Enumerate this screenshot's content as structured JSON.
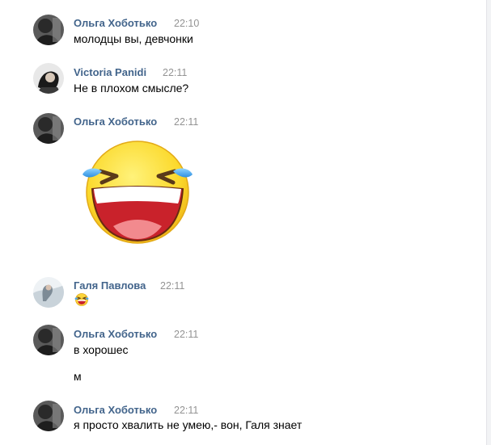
{
  "messages": [
    {
      "author": "Ольга Хоботько",
      "time": "22:10",
      "text": "молодцы вы, девчонки",
      "avatar": "olga-avatar"
    },
    {
      "author": "Victoria Panidi",
      "time": "22:11",
      "text": "Не в плохом смысле?",
      "avatar": "victoria-avatar"
    },
    {
      "author": "Ольга Хоботько",
      "time": "22:11",
      "sticker": "laughing-crying-face-sticker",
      "avatar": "olga-avatar"
    },
    {
      "author": "Галя Павлова",
      "time": "22:11",
      "emoji": "face-with-tears-of-joy-icon",
      "avatar": "galya-avatar"
    },
    {
      "author": "Ольга Хоботько",
      "time": "22:11",
      "text": "в хорошес",
      "text2": "м",
      "avatar": "olga-avatar"
    },
    {
      "author": "Ольга Хоботько",
      "time": "22:11",
      "text": "я просто хвалить не умею,- вон, Галя знает",
      "avatar": "olga-avatar"
    }
  ],
  "colors": {
    "author": "#42648b",
    "time": "#939393",
    "text": "#000000",
    "background": "#ffffff"
  }
}
